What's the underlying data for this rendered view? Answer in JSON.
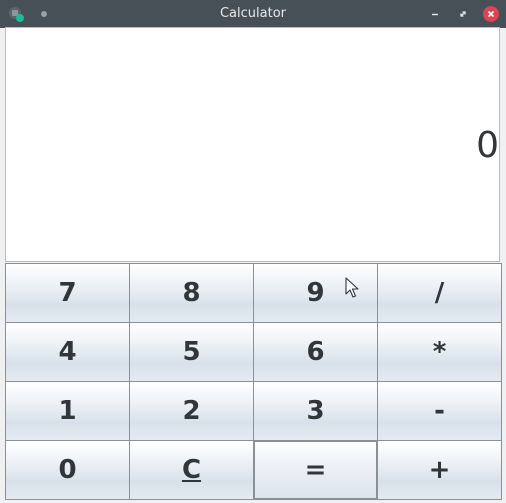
{
  "window": {
    "title": "Calculator"
  },
  "display": {
    "value": "0"
  },
  "keypad": {
    "keys": [
      {
        "label": "7",
        "name": "key-7"
      },
      {
        "label": "8",
        "name": "key-8"
      },
      {
        "label": "9",
        "name": "key-9"
      },
      {
        "label": "/",
        "name": "key-divide"
      },
      {
        "label": "4",
        "name": "key-4"
      },
      {
        "label": "5",
        "name": "key-5"
      },
      {
        "label": "6",
        "name": "key-6"
      },
      {
        "label": "*",
        "name": "key-multiply"
      },
      {
        "label": "1",
        "name": "key-1"
      },
      {
        "label": "2",
        "name": "key-2"
      },
      {
        "label": "3",
        "name": "key-3"
      },
      {
        "label": "-",
        "name": "key-subtract"
      },
      {
        "label": "0",
        "name": "key-0"
      },
      {
        "label": "C",
        "name": "key-clear"
      },
      {
        "label": "=",
        "name": "key-equals"
      },
      {
        "label": "+",
        "name": "key-add"
      }
    ]
  },
  "icons": {
    "app": "calculator-app-icon",
    "minimize": "minimize-icon",
    "maximize": "restore-icon",
    "close": "close-icon",
    "pointer": "mouse-pointer-icon"
  },
  "colors": {
    "titlebar": "#475057",
    "close": "#da4453",
    "display_bg": "#ffffff",
    "key_text": "#31363b"
  }
}
